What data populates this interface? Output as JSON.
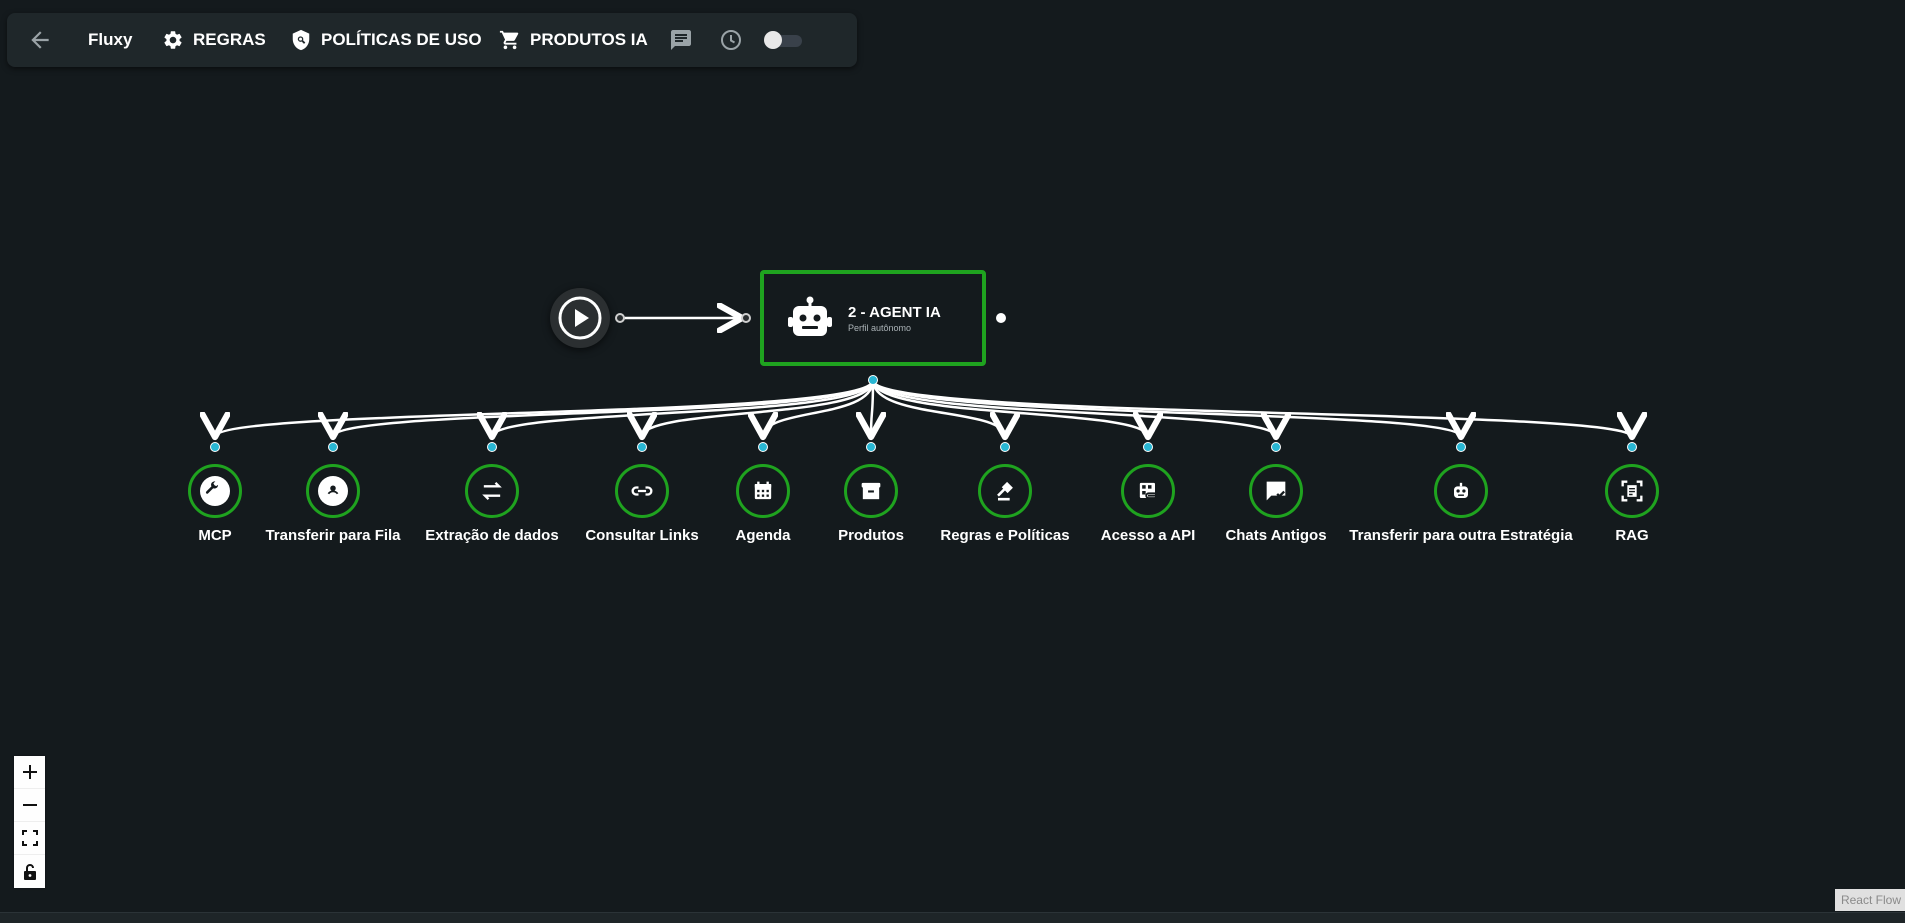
{
  "toolbar": {
    "app_name": "Fluxy",
    "rules_label": "REGRAS",
    "policies_label": "POLÍTICAS DE USO",
    "products_label": "PRODUTOS IA",
    "icons": [
      "arrow-back-icon",
      "gear-icon",
      "shield-search-icon",
      "cart-icon",
      "chat-icon",
      "clock-icon"
    ],
    "toggle_on": false
  },
  "agent_node": {
    "title": "2 - AGENT IA",
    "subtitle": "Perfil autônomo"
  },
  "tools": [
    {
      "label": "MCP",
      "icon": "wrench-icon"
    },
    {
      "label": "Transferir para Fila",
      "icon": "account-pin-icon"
    },
    {
      "label": "Extração de dados",
      "icon": "swap-arrows-icon"
    },
    {
      "label": "Consultar Links",
      "icon": "link-icon"
    },
    {
      "label": "Agenda",
      "icon": "calendar-icon"
    },
    {
      "label": "Produtos",
      "icon": "archive-box-icon"
    },
    {
      "label": "Regras e Políticas",
      "icon": "gavel-icon"
    },
    {
      "label": "Acesso a API",
      "icon": "api-link-icon"
    },
    {
      "label": "Chats Antigos",
      "icon": "chat-check-icon"
    },
    {
      "label": "Transferir para outra Estratégia",
      "icon": "robot-icon"
    },
    {
      "label": "RAG",
      "icon": "document-scan-icon"
    }
  ],
  "attribution": "React Flow",
  "colors": {
    "background": "#141a1d",
    "accent_green": "#1fa31f",
    "handle_cyan": "#29b6d3"
  }
}
